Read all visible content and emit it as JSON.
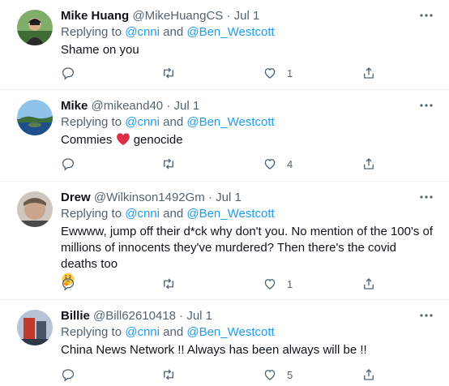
{
  "colors": {
    "link": "#1d9bf0",
    "muted": "#536471",
    "text": "#0f1419",
    "heart": "#f91880",
    "divider": "#eff3f4"
  },
  "tweets": [
    {
      "name": "Mike Huang",
      "handle": "@MikeHuangCS",
      "dot": "·",
      "time": "Jul 1",
      "replying_prefix": "Replying to",
      "mention1": "@cnni",
      "and_word": "and",
      "mention2": "@Ben_Westcott",
      "text": "Shame on you",
      "like_count": "1",
      "icons": [
        "reply-icon",
        "retweet-icon",
        "like-icon",
        "share-icon",
        "more-icon"
      ]
    },
    {
      "name": "Mike",
      "handle": "@mikeand40",
      "dot": "·",
      "time": "Jul 1",
      "replying_prefix": "Replying to",
      "mention1": "@cnni",
      "and_word": "and",
      "mention2": "@Ben_Westcott",
      "text_before": "Commies",
      "text_after": "genocide",
      "like_count": "4",
      "icons": [
        "reply-icon",
        "retweet-icon",
        "like-icon",
        "share-icon",
        "more-icon",
        "red-heart-emoji-icon"
      ]
    },
    {
      "name": "Drew",
      "handle": "@Wilkinson1492Gm",
      "dot": "·",
      "time": "Jul 1",
      "replying_prefix": "Replying to",
      "mention1": "@cnni",
      "and_word": "and",
      "mention2": "@Ben_Westcott",
      "text_line1": "Ewwww, jump off their d*ck why don't you. No mention of the 100's of",
      "text_line2": "millions of innocents they've murdered? Then there's the covid deaths too",
      "like_count": "1",
      "icons": [
        "reply-icon",
        "retweet-icon",
        "like-icon",
        "share-icon",
        "more-icon",
        "thinking-face-emoji-icon"
      ]
    },
    {
      "name": "Billie",
      "handle": "@Bill62610418",
      "dot": "·",
      "time": "Jul 1",
      "replying_prefix": "Replying to",
      "mention1": "@cnni",
      "and_word": "and",
      "mention2": "@Ben_Westcott",
      "text": "China News Network !! Always has been always will be !!",
      "like_count": "5",
      "icons": [
        "reply-icon",
        "retweet-icon",
        "like-icon",
        "share-icon",
        "more-icon"
      ]
    }
  ]
}
